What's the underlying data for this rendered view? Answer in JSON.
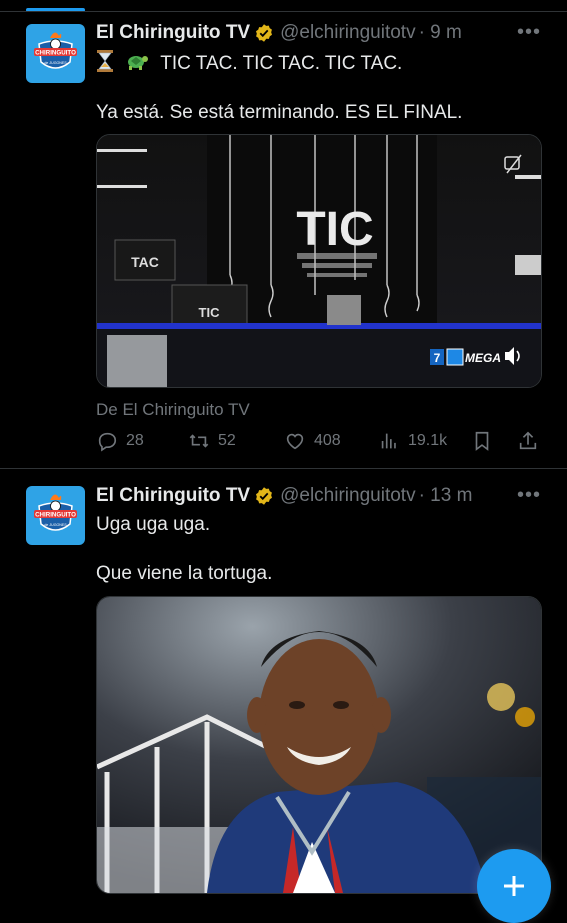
{
  "accent_color": "#1d9bf0",
  "compose_icon": "plus-icon",
  "tweets": [
    {
      "name": "El Chiringuito TV",
      "handle": "@elchiringuitotv",
      "time": "· 9 m",
      "line1": "TIC TAC. TIC TAC. TIC TAC.",
      "line2": "Ya está. Se está terminando. ES EL FINAL.",
      "media": {
        "big_text": "TIC",
        "monitor_text": "TAC",
        "small_text": "TIC",
        "channel": "MEGA",
        "channel_number": "7"
      },
      "source": "De El Chiringuito TV",
      "stats": {
        "replies": "28",
        "retweets": "52",
        "likes": "408",
        "views": "19.1k"
      }
    },
    {
      "name": "El Chiringuito TV",
      "handle": "@elchiringuitotv",
      "time": "· 13 m",
      "line1": "Uga uga uga.",
      "line2": "Que viene la tortuga."
    }
  ],
  "logo": {
    "main": "CHIRINGUITO",
    "sub": "de JUGONES"
  }
}
